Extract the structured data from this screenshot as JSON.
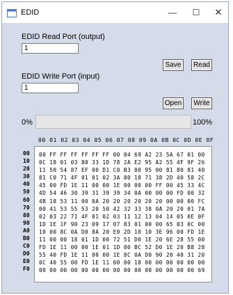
{
  "window": {
    "title": "EDID"
  },
  "titlebar": {
    "minimize": "—",
    "maximize": "☐",
    "close": "✕"
  },
  "read_port": {
    "label": "EDID Read Port (output)",
    "value": "1"
  },
  "write_port": {
    "label": "EDID Write Port (input)",
    "value": "1"
  },
  "buttons": {
    "save": "Save",
    "read": "Read",
    "open": "Open",
    "write": "Write"
  },
  "progress": {
    "min_label": "0%",
    "max_label": "100%",
    "value": 0
  },
  "hex": {
    "header": "00 01 02 03 04 05 06 07 08 09 0A 0B 0C 0D 0E 0F",
    "addresses": [
      "00",
      "10",
      "20",
      "30",
      "40",
      "50",
      "60",
      "70",
      "80",
      "90",
      "A0",
      "B0",
      "C0",
      "D0",
      "E0",
      "F0"
    ],
    "rows": [
      "00 FF FF FF FF FF FF 00 04 69 A2 23 5A 67 01 00",
      "0C 18 01 03 80 33 1D 78 2A E2 95 A2 55 4F 9F 26",
      "11 50 54 87 EF 00 D1 C0 B3 00 95 00 81 80 81 40",
      "81 C0 71 4F 01 01 02 3A 80 18 71 38 2D 40 58 2C",
      "45 00 FD 1E 11 00 00 1E 00 00 00 FF 00 45 33 4C",
      "4D 54 46 30 39 31 39 39 34 0A 00 00 00 FD 00 32",
      "4B 18 53 11 00 0A 20 20 20 20 20 20 00 00 00 FC",
      "00 41 53 55 53 20 50 42 32 33 38 0A 20 20 01 7A",
      "02 03 22 71 4F 01 02 03 11 12 13 04 14 05 0E 0F",
      "1D 1E 1F 90 23 09 17 07 83 01 00 00 65 03 0C 00",
      "10 00 8C 0A D0 8A 20 E0 2D 10 10 3E 96 00 FD 1E",
      "11 00 00 18 01 1D 00 72 51 D0 1E 20 6E 28 55 00",
      "FD 1E 11 00 00 1E 01 1D 00 BC 52 D0 1E 20 B8 28",
      "55 40 FD 1E 11 00 00 1E 8C 0A D0 90 20 40 31 20",
      "0C 40 55 00 FD 1E 11 00 00 18 00 00 00 00 00 00",
      "00 00 00 00 00 00 00 00 00 00 00 00 00 00 00 69"
    ]
  }
}
